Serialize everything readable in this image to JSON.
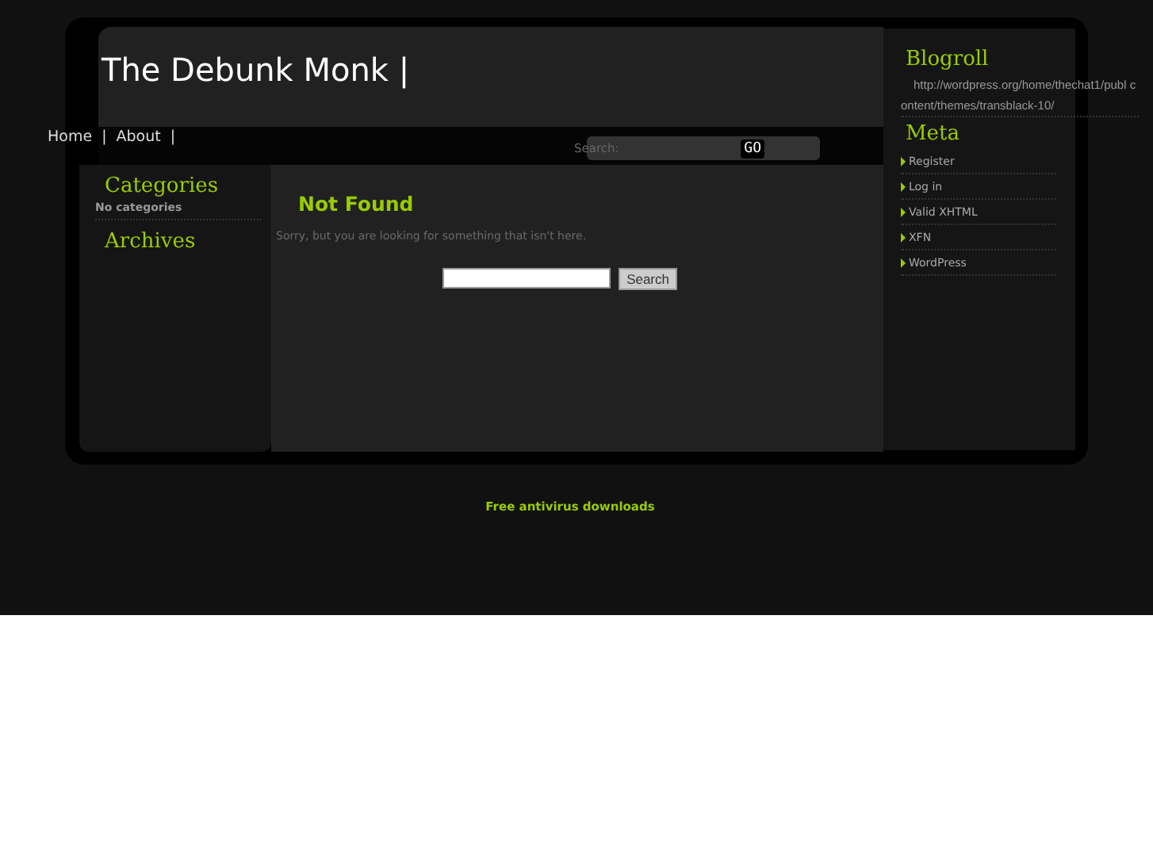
{
  "header": {
    "title": "The Debunk Monk |",
    "nav": [
      {
        "label": "Home",
        "separator": "|"
      },
      {
        "label": "About",
        "separator": "|"
      }
    ],
    "search": {
      "label": "Search:",
      "button": "GO"
    }
  },
  "left_sidebar": {
    "sections": [
      {
        "title": "Categories",
        "items": [
          "No categories"
        ]
      },
      {
        "title": "Archives"
      }
    ]
  },
  "main": {
    "heading": "Not Found",
    "message": "Sorry, but you are looking for something that isn't here.",
    "search_button": "Search"
  },
  "right_sidebar": {
    "blogroll": {
      "title": "Blogroll",
      "link": "http://wordpress.org/home/thechat1/publ content/themes/transblack-10/"
    },
    "meta": {
      "title": "Meta",
      "items": [
        "Register",
        "Log in",
        "Valid XHTML",
        "XFN",
        "WordPress"
      ]
    }
  },
  "footer": {
    "link": "Free antivirus downloads"
  }
}
